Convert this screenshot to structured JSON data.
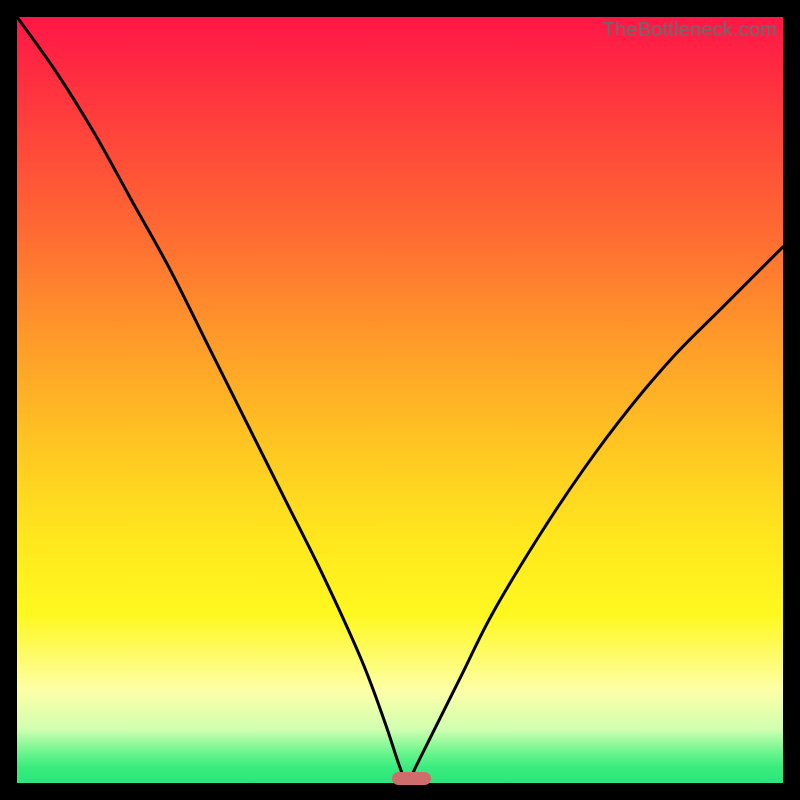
{
  "watermark": "TheBottleneck.com",
  "chart_data": {
    "type": "line",
    "title": "",
    "xlabel": "",
    "ylabel": "",
    "xlim": [
      0,
      100
    ],
    "ylim": [
      0,
      100
    ],
    "min_x": 51,
    "marker": {
      "x_start": 49,
      "x_end": 54,
      "y": 0
    },
    "series": [
      {
        "name": "bottleneck-curve",
        "x": [
          0,
          5,
          10,
          15,
          20,
          25,
          30,
          35,
          40,
          45,
          48,
          50,
          51,
          52,
          54,
          58,
          62,
          68,
          74,
          80,
          86,
          92,
          100
        ],
        "y": [
          100,
          93,
          85,
          76,
          67,
          57,
          47,
          37,
          27,
          16,
          8,
          2,
          0,
          2,
          6,
          14,
          22,
          32,
          41,
          49,
          56,
          62,
          70
        ]
      }
    ],
    "gradient_stops": [
      {
        "pct": 0,
        "color": "#ff1647"
      },
      {
        "pct": 12,
        "color": "#ff3a3d"
      },
      {
        "pct": 28,
        "color": "#ff6a32"
      },
      {
        "pct": 42,
        "color": "#ff9a2a"
      },
      {
        "pct": 55,
        "color": "#ffc322"
      },
      {
        "pct": 68,
        "color": "#ffe71e"
      },
      {
        "pct": 78,
        "color": "#fff81f"
      },
      {
        "pct": 88,
        "color": "#fdffa8"
      },
      {
        "pct": 93,
        "color": "#d0ffb0"
      },
      {
        "pct": 96,
        "color": "#6cf58e"
      },
      {
        "pct": 98,
        "color": "#39ec7d"
      },
      {
        "pct": 100,
        "color": "#2ee57c"
      }
    ]
  }
}
